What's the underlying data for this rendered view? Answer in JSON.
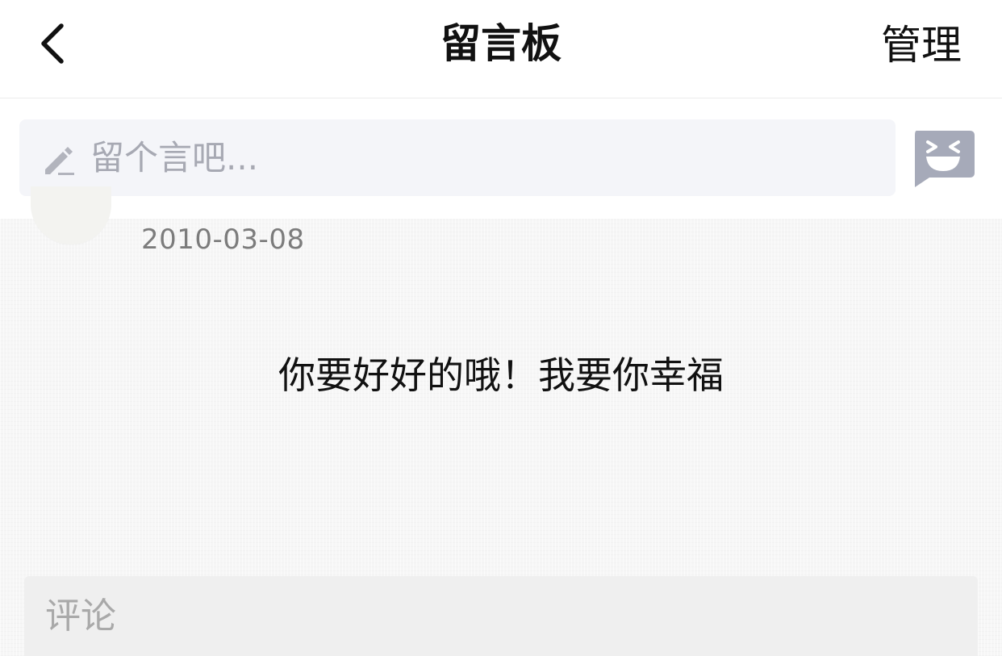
{
  "navbar": {
    "title": "留言板",
    "manage_label": "管理"
  },
  "compose": {
    "placeholder": "留个言吧..."
  },
  "message": {
    "date": "2010-03-08",
    "text": "你要好好的哦！我要你幸福"
  },
  "comment": {
    "placeholder": "评论"
  },
  "colors": {
    "input_bg": "#f4f5f9",
    "emoji_icon": "#a6aab9",
    "placeholder": "#a7a9b3"
  }
}
